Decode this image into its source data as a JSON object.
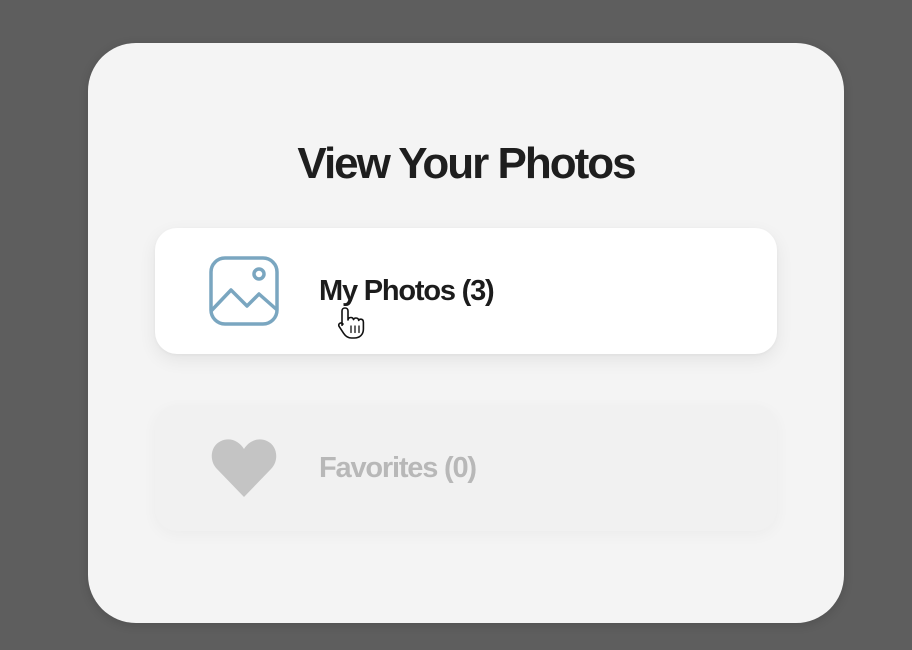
{
  "dialog": {
    "title": "View Your Photos",
    "options": [
      {
        "label": "My Photos (3)",
        "icon": "image-icon",
        "state": "active",
        "icon_color": "#7aa6c0"
      },
      {
        "label": "Favorites (0)",
        "icon": "heart-icon",
        "state": "disabled",
        "icon_color": "#c4c4c4"
      }
    ]
  },
  "colors": {
    "background": "#5e5e5e",
    "card": "#f4f4f4",
    "title_text": "#1e1e1e",
    "active_text": "#1c1c1c",
    "disabled_text": "#b8b8b8"
  },
  "cursor": {
    "icon": "hand-pointer-icon"
  }
}
